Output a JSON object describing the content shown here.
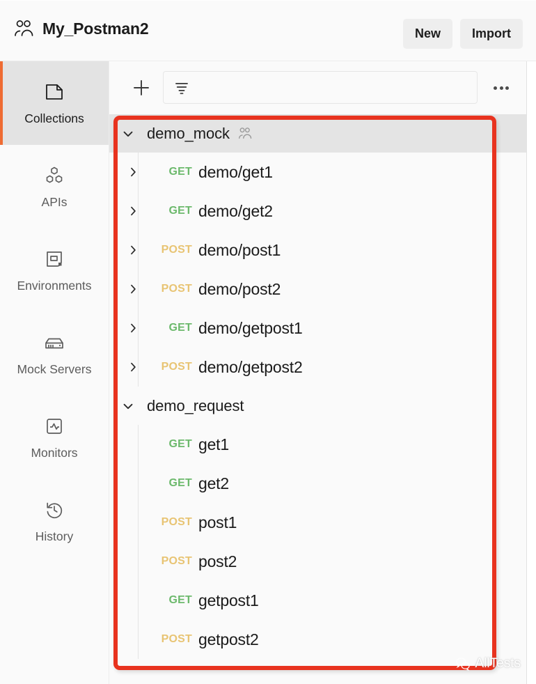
{
  "header": {
    "workspace_icon": "people-icon",
    "title": "My_Postman2",
    "new_label": "New",
    "import_label": "Import"
  },
  "sidebar": {
    "items": [
      {
        "label": "Collections",
        "icon": "collections-icon",
        "active": true
      },
      {
        "label": "APIs",
        "icon": "apis-icon",
        "active": false
      },
      {
        "label": "Environments",
        "icon": "environments-icon",
        "active": false
      },
      {
        "label": "Mock Servers",
        "icon": "mock-servers-icon",
        "active": false
      },
      {
        "label": "Monitors",
        "icon": "monitors-icon",
        "active": false
      },
      {
        "label": "History",
        "icon": "history-icon",
        "active": false
      }
    ]
  },
  "toolbar": {
    "add_icon": "plus-icon",
    "filter_icon": "filter-icon",
    "filter_placeholder": "",
    "filter_value": "",
    "more_icon": "more-horizontal-icon"
  },
  "collections": [
    {
      "name": "demo_mock",
      "expanded": true,
      "selected": true,
      "shared": true,
      "shared_icon": "people-icon",
      "chevron": "chevron-down-icon",
      "items": [
        {
          "method": "GET",
          "name": "demo/get1",
          "chevron": "chevron-right-icon",
          "has_chevron": true
        },
        {
          "method": "GET",
          "name": "demo/get2",
          "chevron": "chevron-right-icon",
          "has_chevron": true
        },
        {
          "method": "POST",
          "name": "demo/post1",
          "chevron": "chevron-right-icon",
          "has_chevron": true
        },
        {
          "method": "POST",
          "name": "demo/post2",
          "chevron": "chevron-right-icon",
          "has_chevron": true
        },
        {
          "method": "GET",
          "name": "demo/getpost1",
          "chevron": "chevron-right-icon",
          "has_chevron": true
        },
        {
          "method": "POST",
          "name": "demo/getpost2",
          "chevron": "chevron-right-icon",
          "has_chevron": true
        }
      ]
    },
    {
      "name": "demo_request",
      "expanded": true,
      "selected": false,
      "shared": false,
      "shared_icon": "",
      "chevron": "chevron-down-icon",
      "items": [
        {
          "method": "GET",
          "name": "get1",
          "chevron": "",
          "has_chevron": false
        },
        {
          "method": "GET",
          "name": "get2",
          "chevron": "",
          "has_chevron": false
        },
        {
          "method": "POST",
          "name": "post1",
          "chevron": "",
          "has_chevron": false
        },
        {
          "method": "POST",
          "name": "post2",
          "chevron": "",
          "has_chevron": false
        },
        {
          "method": "GET",
          "name": "getpost1",
          "chevron": "",
          "has_chevron": false
        },
        {
          "method": "POST",
          "name": "getpost2",
          "chevron": "",
          "has_chevron": false
        }
      ]
    }
  ],
  "annotation": {
    "shape": "rectangle",
    "color": "#e8331f"
  },
  "watermark": {
    "text": "AllTests",
    "icon": "wechat-icon"
  },
  "colors": {
    "accent": "#ef6c33",
    "get": "#6cb96c",
    "post": "#e8c473",
    "selected_row": "#e4e4e4",
    "panel_bg": "#fafafa"
  }
}
